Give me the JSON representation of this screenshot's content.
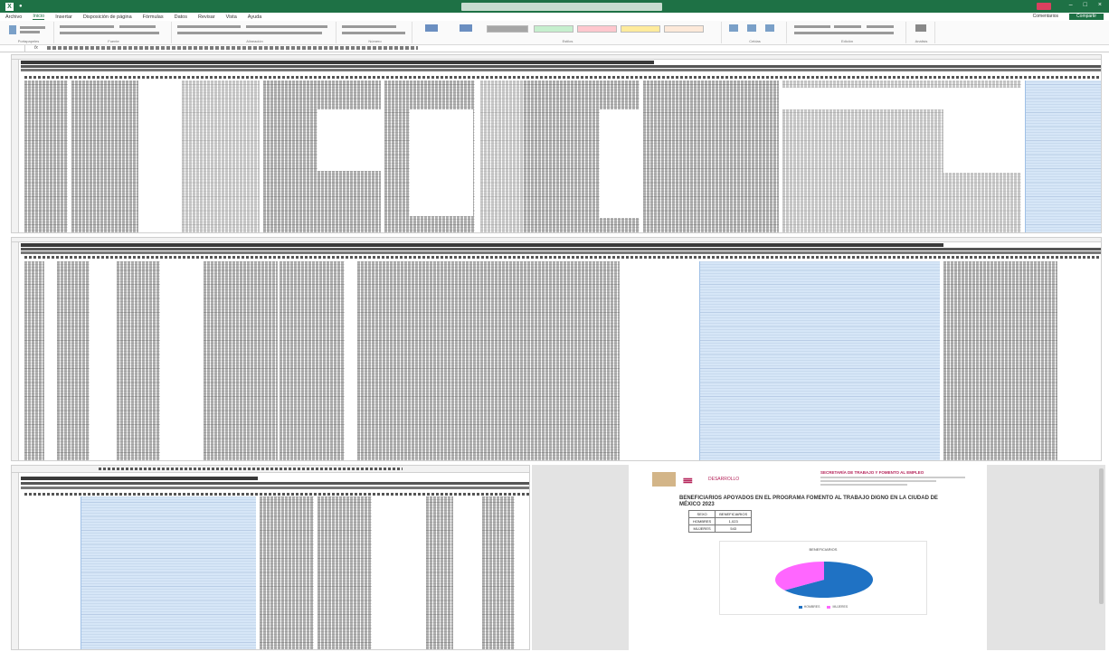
{
  "window": {
    "app_badge": "X",
    "doc_name": "",
    "search_placeholder": "",
    "user": ""
  },
  "menu": {
    "tabs": [
      "Archivo",
      "Inicio",
      "Insertar",
      "Disposición de página",
      "Fórmulas",
      "Datos",
      "Revisar",
      "Vista",
      "Ayuda"
    ],
    "active_tab": "Inicio",
    "share": "Compartir",
    "comments": "Comentarios"
  },
  "ribbon": {
    "groups": [
      "Portapapeles",
      "Fuente",
      "Alineación",
      "Número",
      "Estilos",
      "Celdas",
      "Edición",
      "Análisis"
    ]
  },
  "formula_bar": {
    "fx": "fx"
  },
  "preview": {
    "logo_text": "DESARROLLO",
    "header_right": "SECRETARÍA DE TRABAJO Y FOMENTO AL EMPLEO",
    "title": "BENEFICIARIOS APOYADOS EN EL PROGRAMA FOMENTO AL TRABAJO DIGNO EN LA CIUDAD DE MÉXICO 2023",
    "table": {
      "headers": [
        "SEXO",
        "BENEFICIARIOS"
      ],
      "rows": [
        [
          "HOMBRES",
          "1,023"
        ],
        [
          "MUJERES",
          "543"
        ]
      ]
    },
    "chart_title": "BENEFICIARIOS",
    "footer_left": "",
    "footer_right": ""
  },
  "chart_data": {
    "type": "pie",
    "title": "BENEFICIARIOS",
    "labels": [
      "HOMBRES",
      "MUJERES"
    ],
    "values": [
      65,
      35
    ],
    "colors": [
      "#1f72c4",
      "#ff66ff"
    ]
  },
  "colors": {
    "excel_green": "#1e7145",
    "selection": "#d6e6f7",
    "accent_pink": "#b5245a"
  }
}
